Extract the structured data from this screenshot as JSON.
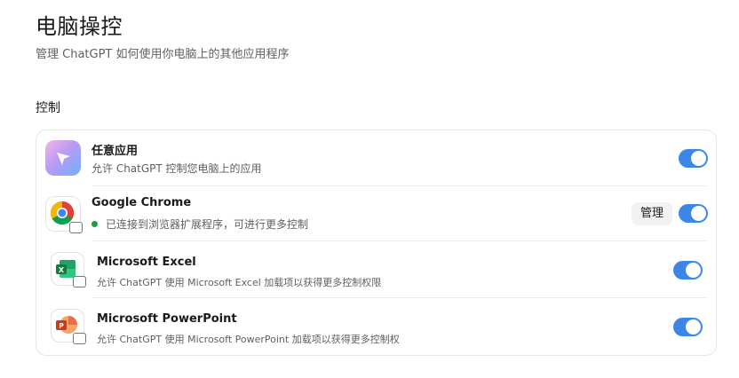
{
  "header": {
    "title": "电脑操控",
    "subtitle": "管理 ChatGPT 如何使用你电脑上的其他应用程序"
  },
  "section": {
    "label": "控制"
  },
  "apps": [
    {
      "name": "任意应用",
      "desc": "允许 ChatGPT 控制您电脑上的应用",
      "icon": "chatgpt-cursor-icon",
      "enabled": true
    },
    {
      "name": "Google Chrome",
      "desc": "已连接到浏览器扩展程序，可进行更多控制",
      "icon": "chrome-icon",
      "enabled": true,
      "status_color": "#1a9e45",
      "manage_label": "管理"
    },
    {
      "name": "Microsoft Excel",
      "desc": "允许 ChatGPT 使用 Microsoft Excel 加载项以获得更多控制权限",
      "icon": "excel-icon",
      "enabled": true
    },
    {
      "name": "Microsoft PowerPoint",
      "desc": "允许 ChatGPT 使用 Microsoft PowerPoint 加载项以获得更多控制权",
      "icon": "powerpoint-icon",
      "enabled": true
    }
  ],
  "colors": {
    "toggle_on": "#3b86e6",
    "accent": "#3b86e6"
  }
}
